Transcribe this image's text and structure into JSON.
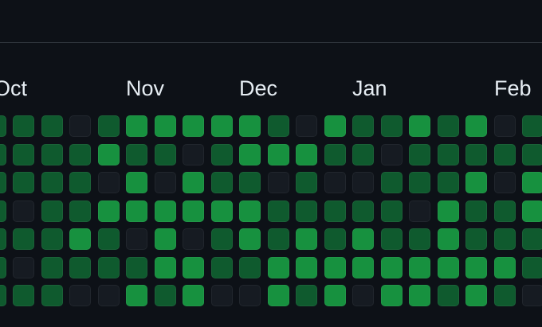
{
  "months": [
    "Oct",
    "Nov",
    "Dec",
    "Jan",
    "Feb"
  ],
  "level_colors": [
    "#161b22",
    "#0f5a2e",
    "#17913f"
  ],
  "contributions_by_row": [
    [
      1,
      1,
      1,
      0,
      1,
      2,
      2,
      2,
      2,
      2,
      1,
      0,
      2,
      1,
      1,
      2,
      1,
      2,
      0,
      1
    ],
    [
      1,
      1,
      1,
      1,
      2,
      1,
      1,
      0,
      1,
      2,
      2,
      2,
      1,
      1,
      0,
      1,
      1,
      1,
      1,
      1
    ],
    [
      1,
      1,
      1,
      1,
      0,
      2,
      0,
      2,
      1,
      1,
      0,
      1,
      0,
      0,
      1,
      1,
      1,
      2,
      0,
      2
    ],
    [
      1,
      0,
      1,
      1,
      2,
      2,
      2,
      2,
      2,
      2,
      1,
      1,
      1,
      1,
      1,
      0,
      2,
      1,
      1,
      2
    ],
    [
      1,
      1,
      1,
      2,
      1,
      0,
      2,
      0,
      1,
      2,
      1,
      2,
      1,
      2,
      1,
      1,
      2,
      1,
      1,
      1
    ],
    [
      1,
      0,
      1,
      1,
      1,
      1,
      2,
      2,
      1,
      1,
      2,
      2,
      2,
      2,
      2,
      2,
      2,
      2,
      2,
      1
    ],
    [
      1,
      1,
      1,
      0,
      0,
      2,
      1,
      2,
      0,
      0,
      2,
      1,
      2,
      0,
      2,
      2,
      1,
      2,
      1,
      0
    ]
  ]
}
